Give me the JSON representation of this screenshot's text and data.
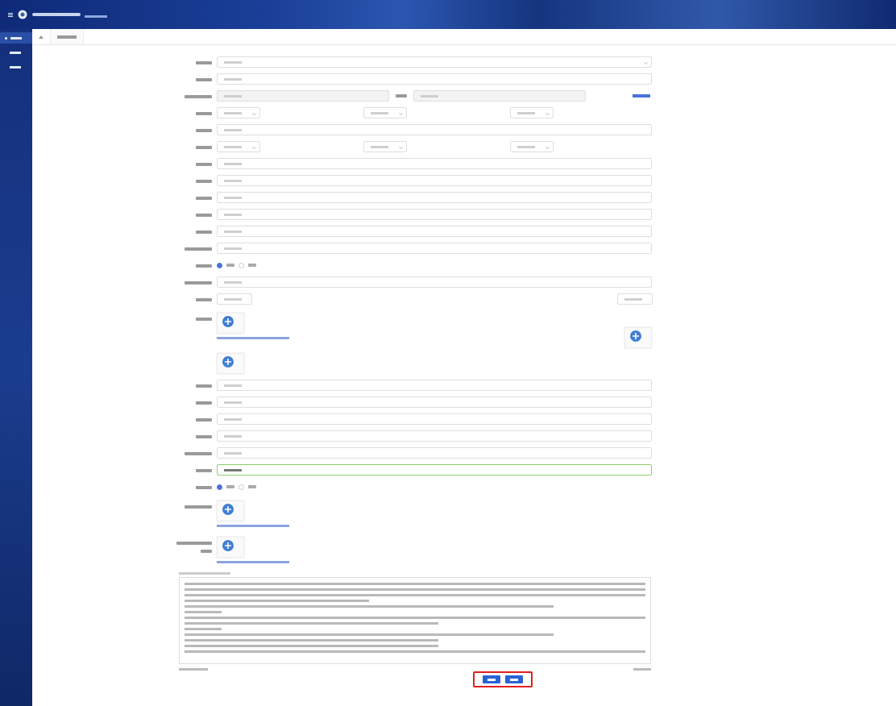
{
  "sidebar": {
    "items": [
      {
        "selected": true
      },
      {
        "selected": false
      },
      {
        "selected": false
      }
    ]
  },
  "tabs": [
    {
      "selected": true
    }
  ],
  "form": {
    "rows": [
      {
        "kind": "select",
        "label": {
          "kind": "short"
        }
      },
      {
        "kind": "input",
        "label": {
          "kind": "short"
        }
      },
      {
        "kind": "pair",
        "label": {
          "kind": "long"
        },
        "disabled": true
      },
      {
        "kind": "triple",
        "label": {
          "kind": "short"
        }
      },
      {
        "kind": "input",
        "label": {
          "kind": "short"
        }
      },
      {
        "kind": "triple",
        "label": {
          "kind": "short"
        }
      },
      {
        "kind": "input",
        "label": {
          "kind": "short"
        }
      },
      {
        "kind": "input",
        "label": {
          "kind": "short"
        }
      },
      {
        "kind": "input",
        "label": {
          "kind": "short"
        }
      },
      {
        "kind": "input",
        "label": {
          "kind": "short"
        }
      },
      {
        "kind": "input",
        "label": {
          "kind": "short"
        }
      },
      {
        "kind": "input",
        "label": {
          "kind": "long"
        }
      },
      {
        "kind": "radio",
        "label": {
          "kind": "short"
        },
        "options": [
          {
            "selected": true
          },
          {
            "selected": false
          }
        ]
      },
      {
        "kind": "input",
        "label": {
          "kind": "long"
        }
      },
      {
        "kind": "dual",
        "label": {
          "kind": "short"
        }
      },
      {
        "kind": "upload-pair",
        "label": {
          "kind": "short"
        }
      },
      {
        "kind": "upload"
      },
      {
        "kind": "input",
        "label": {
          "kind": "short"
        }
      },
      {
        "kind": "input",
        "label": {
          "kind": "short"
        }
      },
      {
        "kind": "input",
        "label": {
          "kind": "short"
        }
      },
      {
        "kind": "input",
        "label": {
          "kind": "short"
        }
      },
      {
        "kind": "input",
        "label": {
          "kind": "long"
        }
      },
      {
        "kind": "input",
        "label": {
          "kind": "short"
        },
        "focused": true
      },
      {
        "kind": "radio",
        "label": {
          "kind": "short"
        },
        "options": [
          {
            "selected": true
          },
          {
            "selected": false
          }
        ]
      },
      {
        "kind": "upload-hint",
        "label": {
          "kind": "long"
        }
      },
      {
        "kind": "upload-hint",
        "label": {
          "kind": "double"
        }
      }
    ]
  },
  "agreement": {
    "paragraphs": [
      {
        "kind": "full"
      },
      {
        "kind": "full"
      },
      {
        "kind": "full"
      },
      {
        "kind": "short"
      },
      {
        "kind": "wide"
      },
      {
        "kind": "tiny"
      },
      {
        "kind": "full"
      },
      {
        "kind": "half"
      },
      {
        "kind": "tiny"
      },
      {
        "kind": "wide"
      },
      {
        "kind": "half"
      },
      {
        "kind": "half"
      },
      {
        "kind": "full"
      }
    ]
  },
  "actions": {
    "highlighted": true,
    "buttons": [
      {
        "kind": "primary"
      },
      {
        "kind": "primary"
      }
    ]
  }
}
